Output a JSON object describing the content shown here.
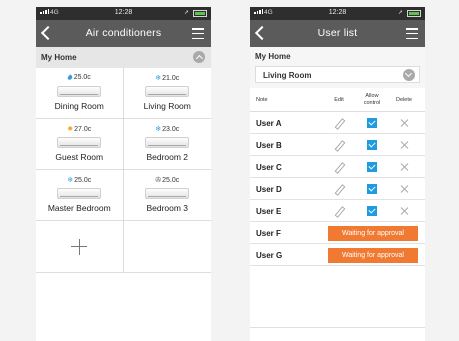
{
  "status_bar": {
    "network": "4G",
    "time": "12:28"
  },
  "left_screen": {
    "title": "Air conditioners",
    "home_label": "My Home",
    "rooms": [
      {
        "name": "Dining Room",
        "temp": "25.0c",
        "mode": "drop-icon"
      },
      {
        "name": "Living Room",
        "temp": "21.0c",
        "mode": "snowflake-icon"
      },
      {
        "name": "Guest Room",
        "temp": "27.0c",
        "mode": "sun-icon"
      },
      {
        "name": "Bedroom 2",
        "temp": "23.0c",
        "mode": "snowflake-icon"
      },
      {
        "name": "Master Bedroom",
        "temp": "25.0c",
        "mode": "snowflake-icon"
      },
      {
        "name": "Bedroom 3",
        "temp": "25.0c",
        "mode": "fan-icon"
      }
    ]
  },
  "right_screen": {
    "title": "User list",
    "home_label": "My Home",
    "room_selected": "Living Room",
    "columns": {
      "note": "Note",
      "edit": "Edit",
      "allow": "Allow control",
      "delete": "Delete"
    },
    "users": [
      {
        "name": "User A",
        "allowed": true
      },
      {
        "name": "User B",
        "allowed": true
      },
      {
        "name": "User C",
        "allowed": true
      },
      {
        "name": "User D",
        "allowed": true
      },
      {
        "name": "User E",
        "allowed": true
      },
      {
        "name": "User F",
        "status": "Waiting for approval"
      },
      {
        "name": "User G",
        "status": "Waiting for approval"
      }
    ]
  }
}
